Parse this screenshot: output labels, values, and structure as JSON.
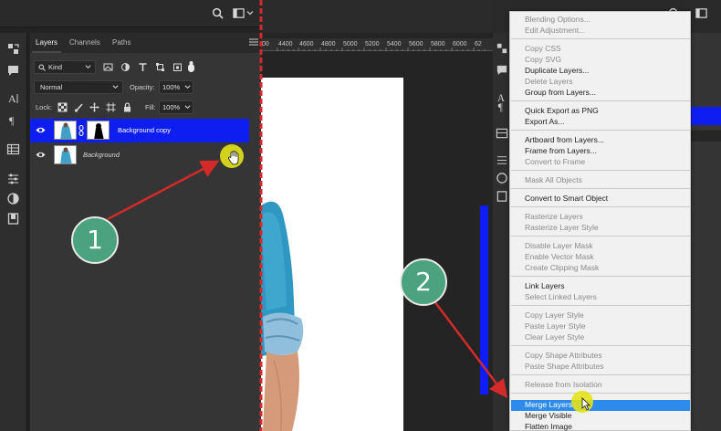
{
  "layers_panel": {
    "tabs": [
      "Layers",
      "Channels",
      "Paths"
    ],
    "filter_kind": "Kind",
    "blend_mode": "Normal",
    "opacity_label": "Opacity:",
    "opacity_value": "100%",
    "lock_label": "Lock:",
    "fill_label": "Fill:",
    "fill_value": "100%",
    "layers": [
      {
        "name": "Background copy",
        "selected": true
      },
      {
        "name": "Background",
        "selected": false
      }
    ]
  },
  "ruler": {
    "labels": [
      "00",
      "4400",
      "4600",
      "4800",
      "5000",
      "5200",
      "5400",
      "5600",
      "5800",
      "6000",
      "62"
    ]
  },
  "context_menu": {
    "items": [
      {
        "label": "Blending Options...",
        "enabled": false
      },
      {
        "label": "Edit Adjustment...",
        "enabled": false
      },
      {
        "label": "Copy CSS",
        "enabled": false
      },
      {
        "label": "Copy SVG",
        "enabled": false
      },
      {
        "label": "Duplicate Layers...",
        "enabled": true
      },
      {
        "label": "Delete Layers",
        "enabled": false
      },
      {
        "label": "Group from Layers...",
        "enabled": true
      },
      {
        "label": "Quick Export as PNG",
        "enabled": true
      },
      {
        "label": "Export As...",
        "enabled": true
      },
      {
        "label": "Artboard from Layers...",
        "enabled": true
      },
      {
        "label": "Frame from Layers...",
        "enabled": true
      },
      {
        "label": "Convert to Frame",
        "enabled": false
      },
      {
        "label": "Mask All Objects",
        "enabled": false
      },
      {
        "label": "Convert to Smart Object",
        "enabled": true
      },
      {
        "label": "Rasterize Layers",
        "enabled": false
      },
      {
        "label": "Rasterize Layer Style",
        "enabled": false
      },
      {
        "label": "Disable Layer Mask",
        "enabled": false
      },
      {
        "label": "Enable Vector Mask",
        "enabled": false
      },
      {
        "label": "Create Clipping Mask",
        "enabled": false
      },
      {
        "label": "Link Layers",
        "enabled": true
      },
      {
        "label": "Select Linked Layers",
        "enabled": false
      },
      {
        "label": "Copy Layer Style",
        "enabled": false
      },
      {
        "label": "Paste Layer Style",
        "enabled": false
      },
      {
        "label": "Clear Layer Style",
        "enabled": false
      },
      {
        "label": "Copy Shape Attributes",
        "enabled": false
      },
      {
        "label": "Paste Shape Attributes",
        "enabled": false
      },
      {
        "label": "Release from Isolation",
        "enabled": false
      },
      {
        "label": "Merge Layers",
        "enabled": true,
        "highlighted": true
      },
      {
        "label": "Merge Visible",
        "enabled": true
      },
      {
        "label": "Flatten Image",
        "enabled": true
      }
    ]
  },
  "annotations": {
    "step_1": "1",
    "step_2": "2"
  },
  "colors": {
    "selection_blue": "#0f1ef0",
    "menu_highlight": "#2d8ceb",
    "badge_green": "#4aa37e",
    "arrow_red": "#d42a2a",
    "cursor_yellow": "#e3e21a"
  }
}
